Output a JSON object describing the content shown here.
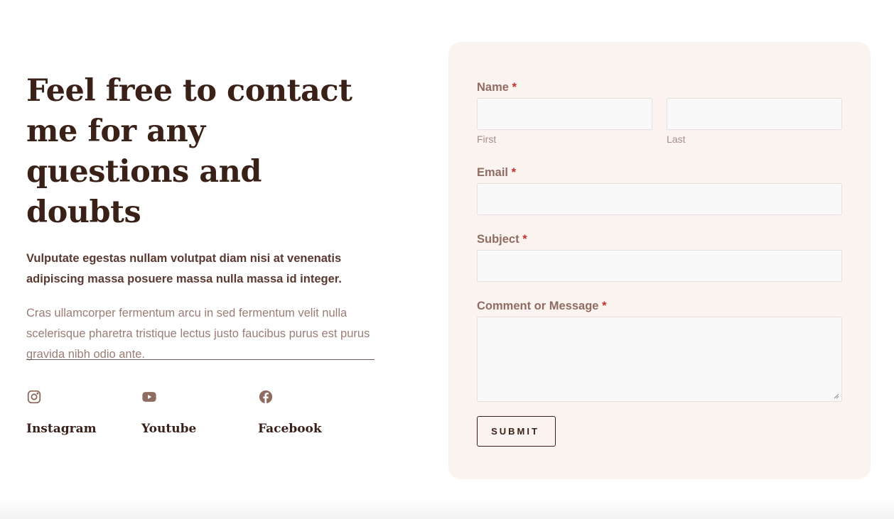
{
  "intro": {
    "heading": "Feel free to contact me for any questions and doubts",
    "lead": "Vulputate egestas nullam volutpat diam nisi at venenatis adipiscing massa posuere massa nulla massa id integer.",
    "body": "Cras ullamcorper fermentum arcu in sed fermentum velit nulla scelerisque pharetra tristique lectus justo faucibus purus est purus gravida nibh odio ante."
  },
  "social": [
    {
      "label": "Instagram",
      "icon": "instagram-icon"
    },
    {
      "label": "Youtube",
      "icon": "youtube-icon"
    },
    {
      "label": "Facebook",
      "icon": "facebook-icon"
    }
  ],
  "form": {
    "required_mark": "*",
    "name": {
      "label": "Name",
      "first": "First",
      "last": "Last",
      "first_value": "",
      "last_value": ""
    },
    "email": {
      "label": "Email",
      "value": ""
    },
    "subject": {
      "label": "Subject",
      "value": ""
    },
    "message": {
      "label": "Comment or Message",
      "value": ""
    },
    "submit": "SUBMIT"
  },
  "colors": {
    "heading": "#3a2118",
    "muted_text": "#9a7d74",
    "card_bg": "#fbf3f0",
    "required": "#c3312c"
  }
}
